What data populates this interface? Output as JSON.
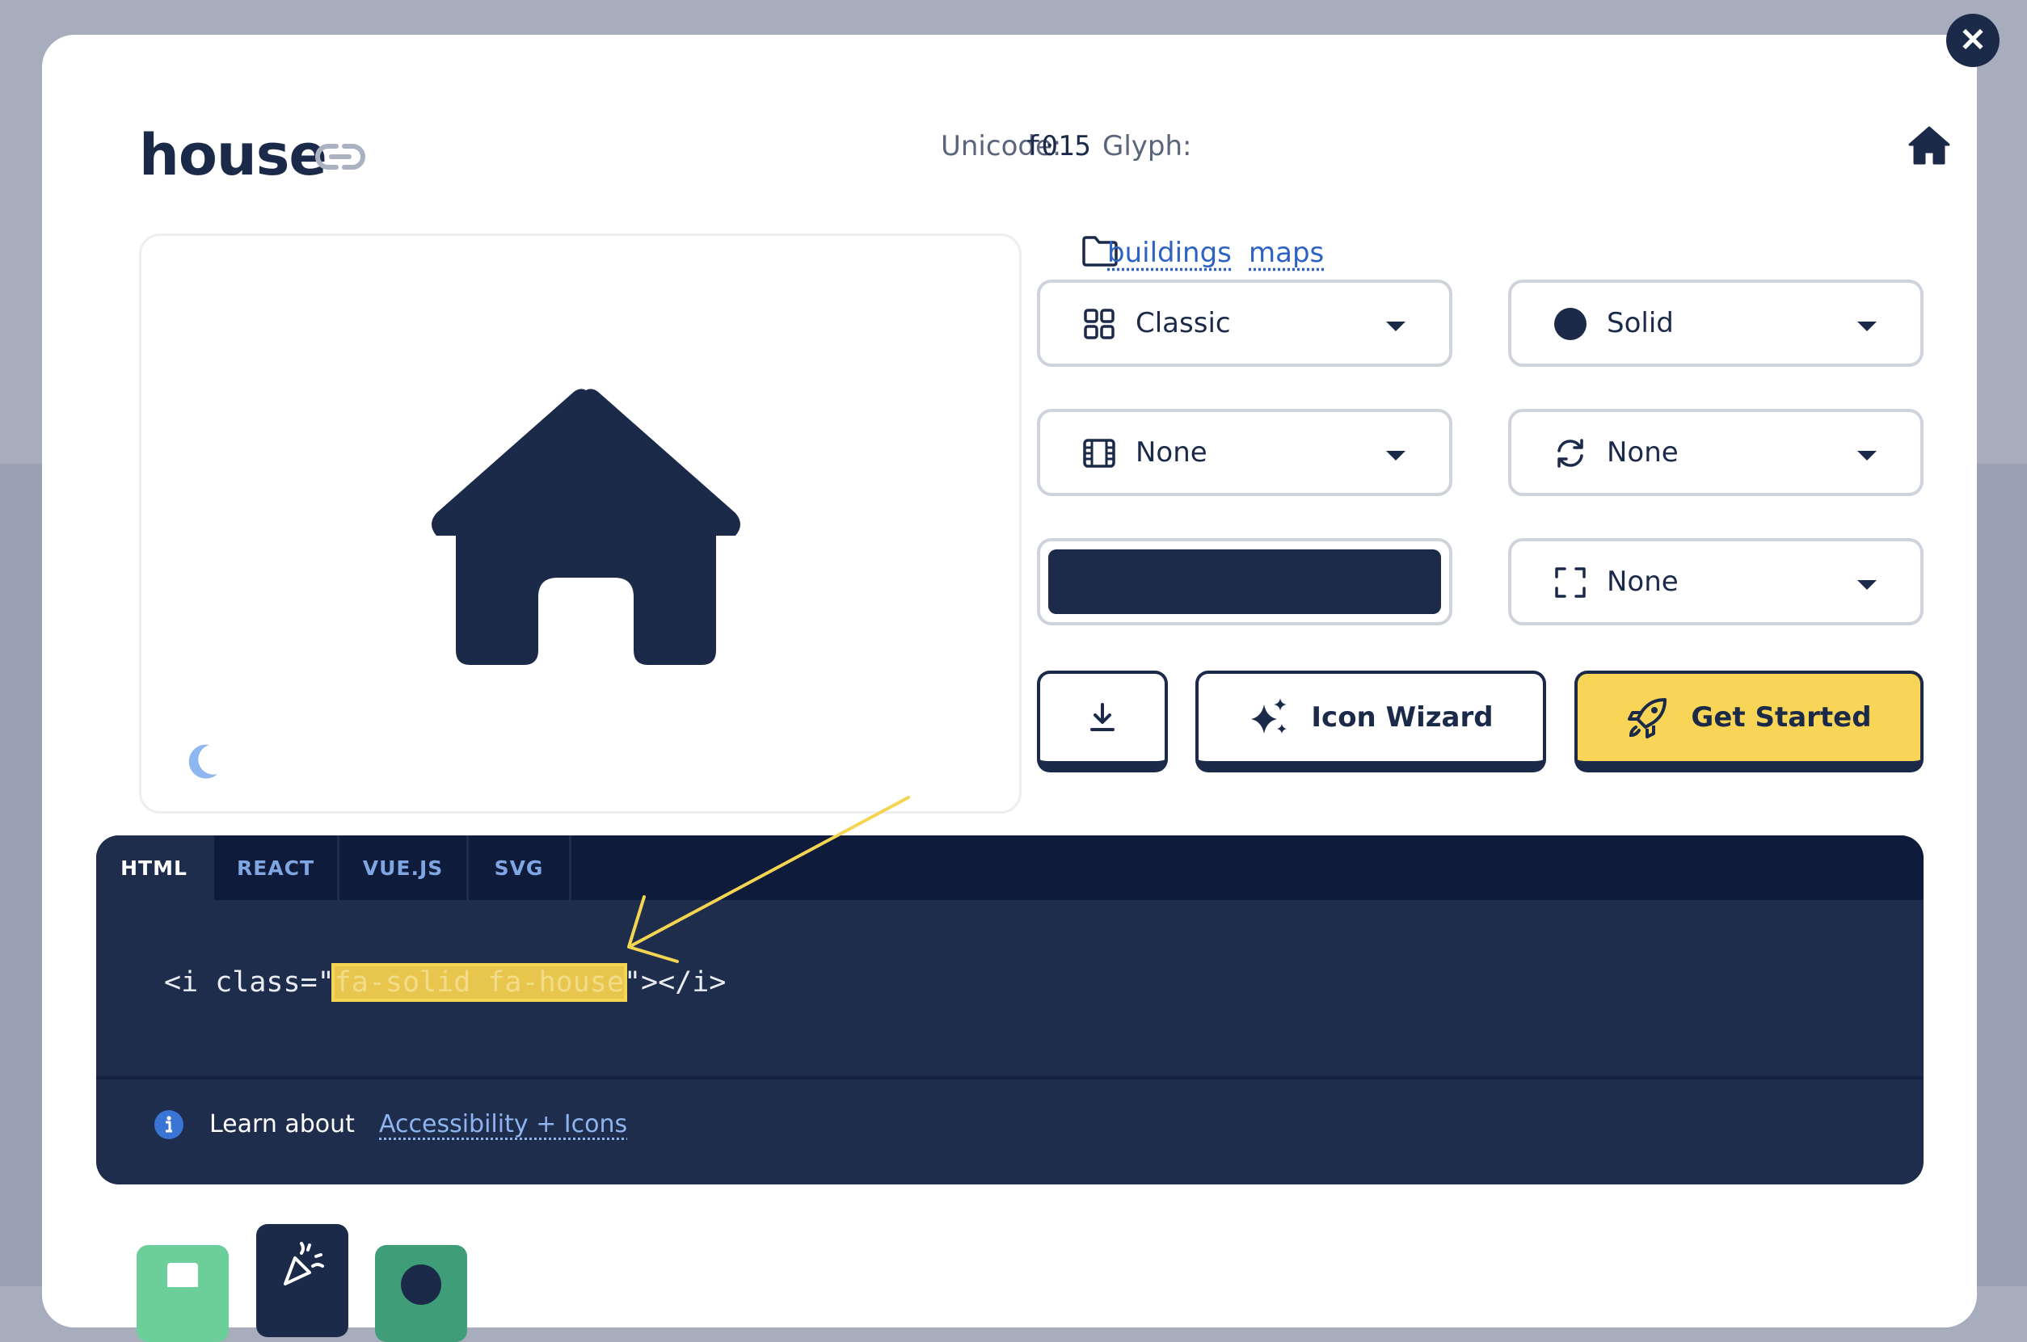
{
  "icon": {
    "name": "house",
    "unicode_label": "Unicode:",
    "unicode_value": "f015",
    "glyph_label": "Glyph:"
  },
  "categories": [
    "buildings",
    "maps"
  ],
  "selects": {
    "family": {
      "label": "Classic",
      "icon": "grid-icon"
    },
    "style": {
      "label": "Solid",
      "icon": "circle-icon"
    },
    "animation": {
      "label": "None",
      "icon": "film-icon"
    },
    "rotation": {
      "label": "None",
      "icon": "rotate-icon"
    },
    "size": {
      "label": "None",
      "icon": "expand-icon"
    }
  },
  "color": {
    "value": "#1d2b4a"
  },
  "buttons": {
    "download_icon": "download-icon",
    "wizard_label": "Icon Wizard",
    "get_started_label": "Get Started"
  },
  "code": {
    "tabs": [
      "HTML",
      "REACT",
      "VUE.JS",
      "SVG"
    ],
    "active_tab": "HTML",
    "prefix": "<i class=\"",
    "highlighted": "fa-solid fa-house",
    "suffix": "\"></i>",
    "learn_text": "Learn about",
    "link_text": "Accessibility + Icons"
  },
  "colors": {
    "navy": "#1c2a4a",
    "yellow": "#f8d457",
    "link_blue": "#2d62c3",
    "annotation_yellow": "#f4d552"
  }
}
